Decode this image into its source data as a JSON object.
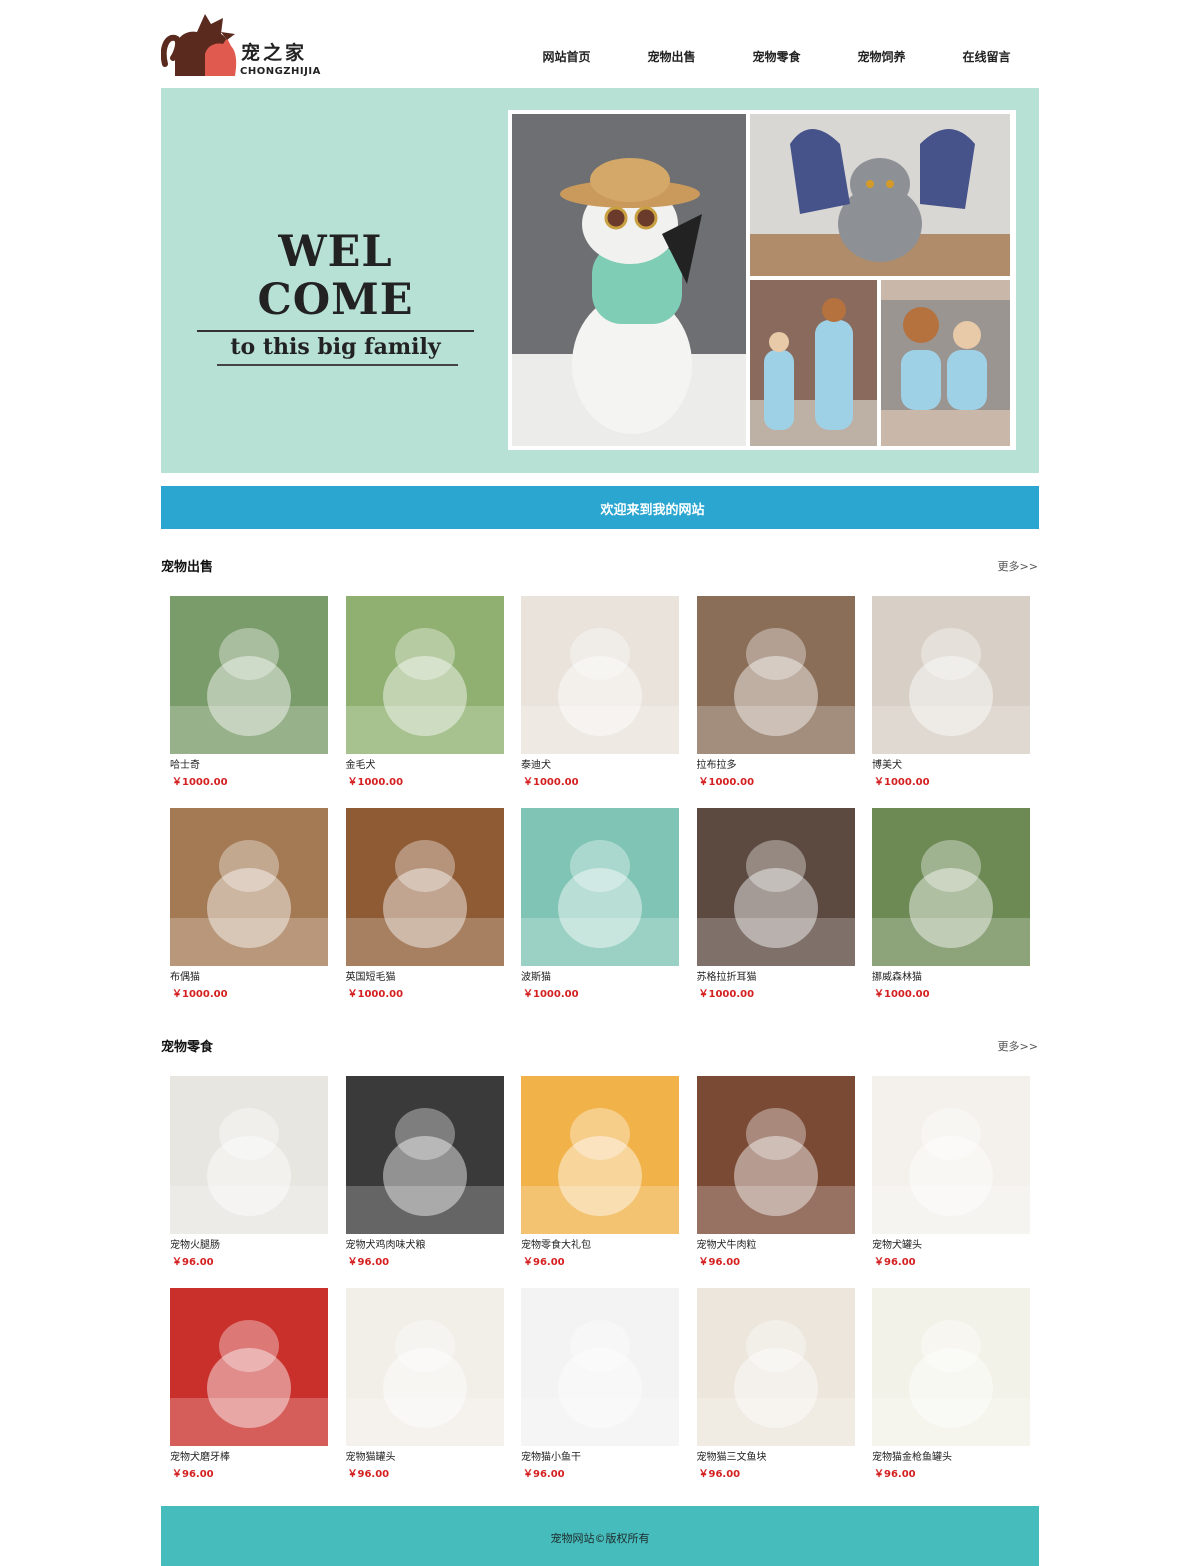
{
  "logo": {
    "name_cn": "宠之家",
    "name_en": "CHONGZHIJIA"
  },
  "nav": [
    {
      "label": "网站首页"
    },
    {
      "label": "宠物出售"
    },
    {
      "label": "宠物零食"
    },
    {
      "label": "宠物饲养"
    },
    {
      "label": "在线留言"
    }
  ],
  "banner": {
    "title": "WEL COME",
    "subtitle": "to this big family"
  },
  "welcome_bar": "欢迎来到我的网站",
  "sale": {
    "title": "宠物出售",
    "more": "更多>>",
    "items": [
      {
        "name": "哈士奇",
        "price": "￥1000.00",
        "color": "#7a9b6a"
      },
      {
        "name": "金毛犬",
        "price": "￥1000.00",
        "color": "#8fb070"
      },
      {
        "name": "泰迪犬",
        "price": "￥1000.00",
        "color": "#e9e3dc"
      },
      {
        "name": "拉布拉多",
        "price": "￥1000.00",
        "color": "#8a6e58"
      },
      {
        "name": "博美犬",
        "price": "￥1000.00",
        "color": "#d8cfc6"
      },
      {
        "name": "布偶猫",
        "price": "￥1000.00",
        "color": "#a47a55"
      },
      {
        "name": "英国短毛猫",
        "price": "￥1000.00",
        "color": "#8f5b35"
      },
      {
        "name": "波斯猫",
        "price": "￥1000.00",
        "color": "#7fc4b4"
      },
      {
        "name": "苏格拉折耳猫",
        "price": "￥1000.00",
        "color": "#5c4a40"
      },
      {
        "name": "挪威森林猫",
        "price": "￥1000.00",
        "color": "#6d8a55"
      }
    ]
  },
  "snacks": {
    "title": "宠物零食",
    "more": "更多>>",
    "items": [
      {
        "name": "宠物火腿肠",
        "price": "￥96.00",
        "color": "#e8e6e1"
      },
      {
        "name": "宠物犬鸡肉味犬粮",
        "price": "￥96.00",
        "color": "#3a3a3a"
      },
      {
        "name": "宠物零食大礼包",
        "price": "￥96.00",
        "color": "#f1b24a"
      },
      {
        "name": "宠物犬牛肉粒",
        "price": "￥96.00",
        "color": "#7a4a35"
      },
      {
        "name": "宠物犬罐头",
        "price": "￥96.00",
        "color": "#f4f1ec"
      },
      {
        "name": "宠物犬磨牙棒",
        "price": "￥96.00",
        "color": "#c9302c"
      },
      {
        "name": "宠物猫罐头",
        "price": "￥96.00",
        "color": "#f2efe9"
      },
      {
        "name": "宠物猫小鱼干",
        "price": "￥96.00",
        "color": "#f3f3f3"
      },
      {
        "name": "宠物猫三文鱼块",
        "price": "￥96.00",
        "color": "#ece6dc"
      },
      {
        "name": "宠物猫金枪鱼罐头",
        "price": "￥96.00",
        "color": "#f3f2e8"
      }
    ]
  },
  "footer": "宠物网站©版权所有"
}
